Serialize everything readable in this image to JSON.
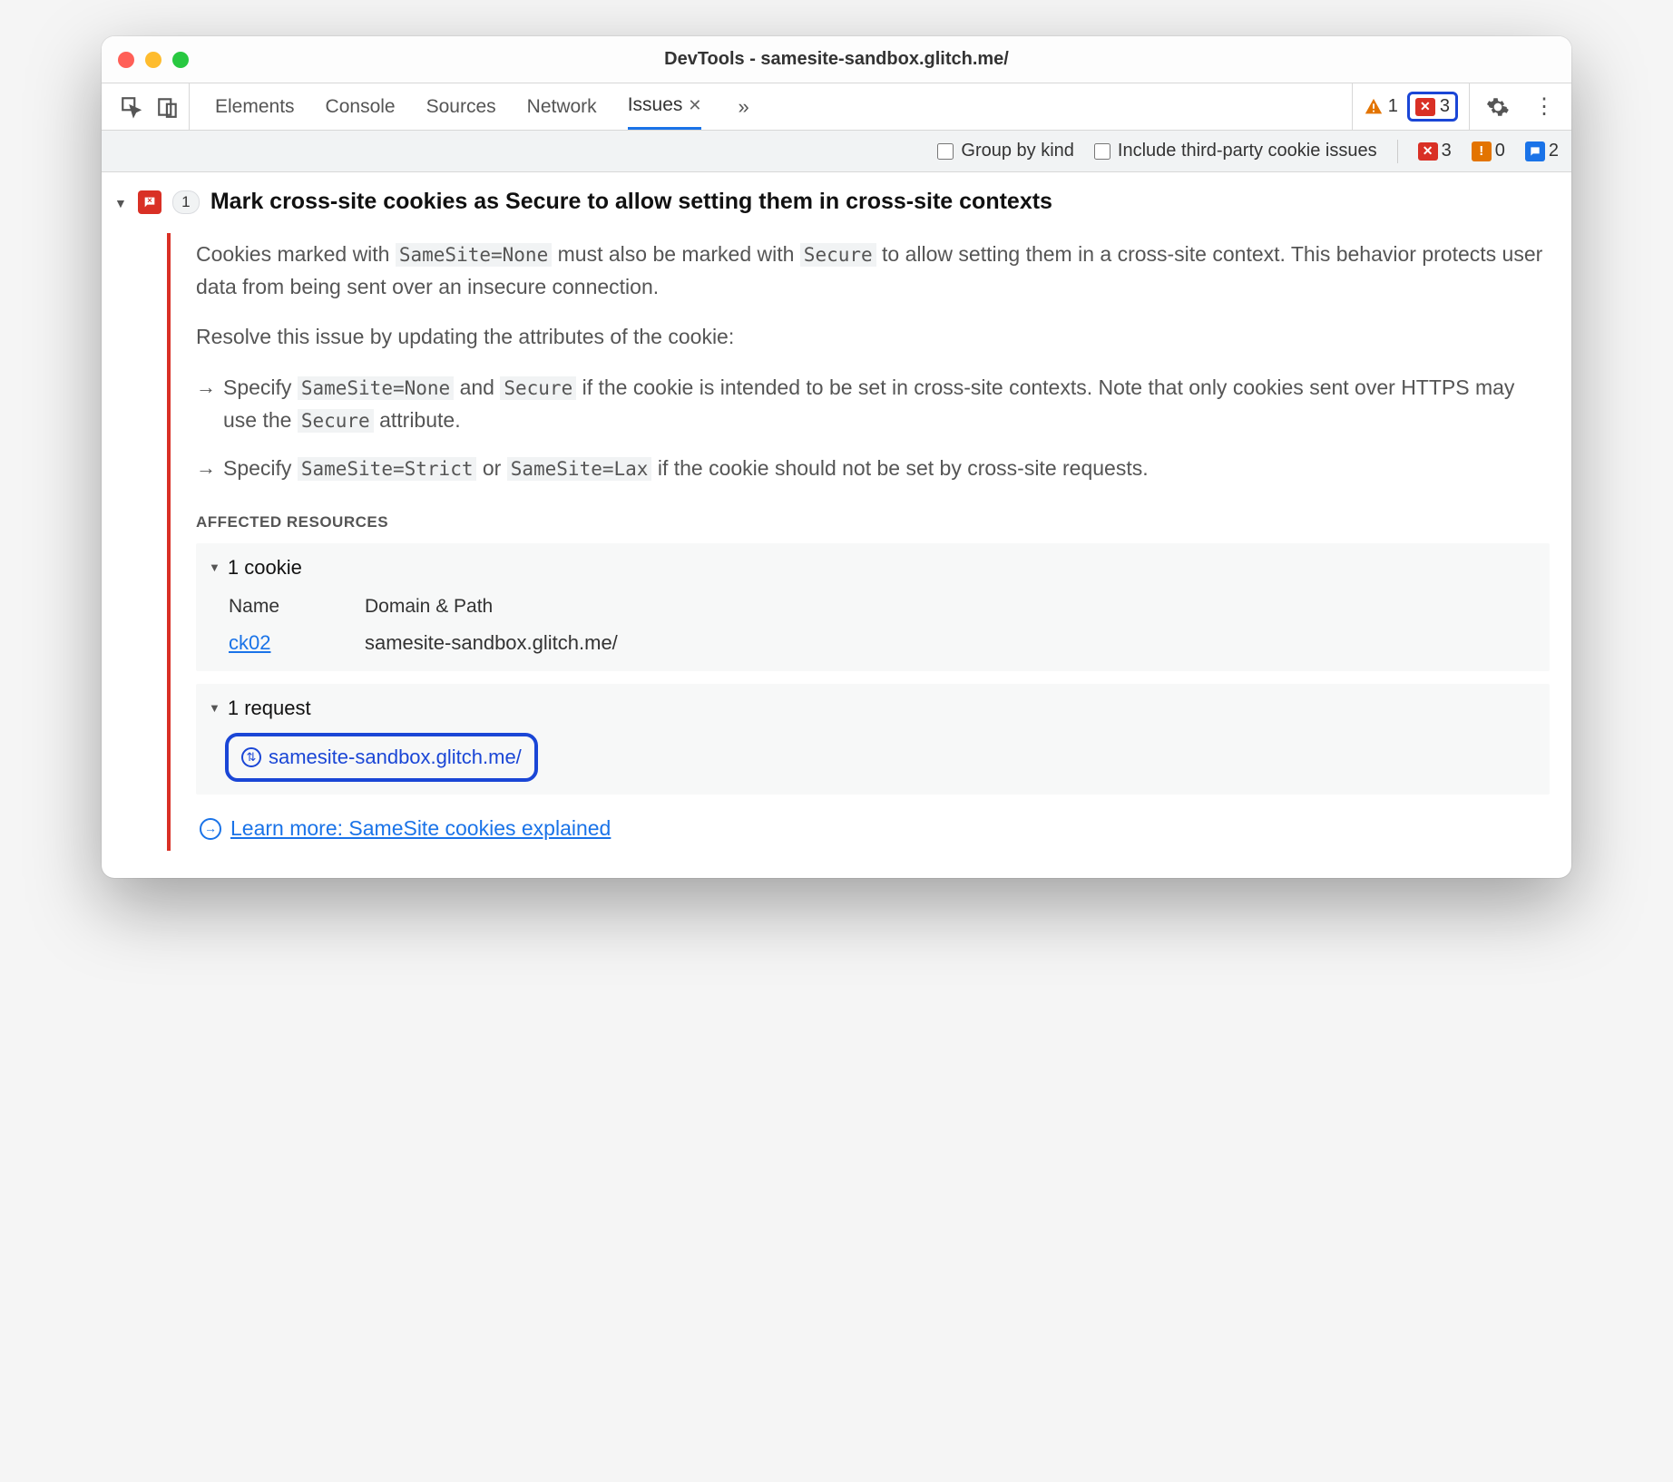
{
  "window": {
    "title": "DevTools - samesite-sandbox.glitch.me/"
  },
  "tabs": {
    "items": [
      "Elements",
      "Console",
      "Sources",
      "Network"
    ],
    "active": "Issues",
    "close_glyph": "✕",
    "overflow_glyph": "»"
  },
  "status": {
    "warn_count": "1",
    "error_count_highlight": "3"
  },
  "filters": {
    "group_label": "Group by kind",
    "third_party_label": "Include third-party cookie issues",
    "counts": {
      "errors": "3",
      "warnings": "0",
      "info": "2"
    }
  },
  "issue": {
    "count": "1",
    "title": "Mark cross-site cookies as Secure to allow setting them in cross-site contexts",
    "para1_a": "Cookies marked with ",
    "para1_code1": "SameSite=None",
    "para1_b": " must also be marked with ",
    "para1_code2": "Secure",
    "para1_c": " to allow setting them in a cross-site context. This behavior protects user data from being sent over an insecure connection.",
    "para2": "Resolve this issue by updating the attributes of the cookie:",
    "b1_a": "Specify ",
    "b1_code1": "SameSite=None",
    "b1_b": " and ",
    "b1_code2": "Secure",
    "b1_c": " if the cookie is intended to be set in cross-site contexts. Note that only cookies sent over HTTPS may use the ",
    "b1_code3": "Secure",
    "b1_d": " attribute.",
    "b2_a": "Specify ",
    "b2_code1": "SameSite=Strict",
    "b2_b": " or ",
    "b2_code2": "SameSite=Lax",
    "b2_c": " if the cookie should not be set by cross-site requests.",
    "affected_header": "AFFECTED RESOURCES",
    "cookies": {
      "header": "1 cookie",
      "col_name": "Name",
      "col_domain": "Domain & Path",
      "row_name": "ck02",
      "row_domain": "samesite-sandbox.glitch.me/"
    },
    "requests": {
      "header": "1 request",
      "url": "samesite-sandbox.glitch.me/"
    },
    "learn_more": "Learn more: SameSite cookies explained"
  }
}
